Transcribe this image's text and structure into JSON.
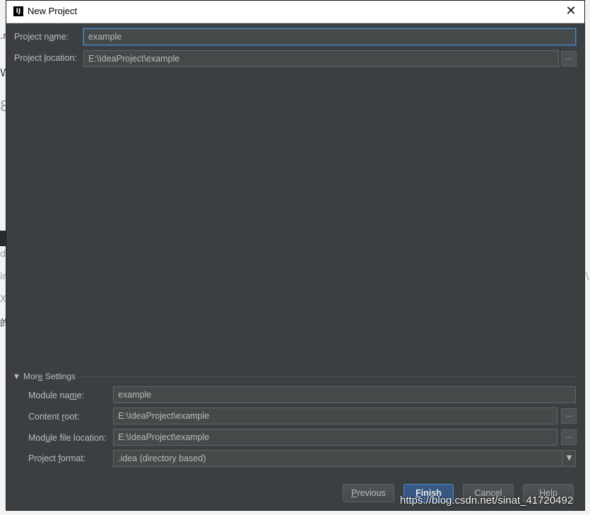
{
  "window": {
    "title": "New Project",
    "app_icon": "intellij-icon",
    "close_glyph": "✕"
  },
  "project": {
    "name_label_pre": "Project n",
    "name_label_mn": "a",
    "name_label_post": "me:",
    "name_value": "example",
    "location_label_pre": "Project ",
    "location_label_mn": "l",
    "location_label_post": "ocation:",
    "location_value": "E:\\IdeaProject\\example",
    "browse_glyph": "..."
  },
  "more_settings": {
    "toggle_glyph": "▼",
    "label_pre": "Mor",
    "label_mn": "e",
    "label_post": " Settings",
    "module_name_label_pre": "Module na",
    "module_name_label_mn": "m",
    "module_name_label_post": "e:",
    "module_name_value": "example",
    "content_root_label_pre": "Content ",
    "content_root_label_mn": "r",
    "content_root_label_post": "oot:",
    "content_root_value": "E:\\IdeaProject\\example",
    "module_file_label_pre": "Mod",
    "module_file_label_mn": "u",
    "module_file_label_post": "le file location:",
    "module_file_value": "E:\\IdeaProject\\example",
    "project_format_label_pre": "Project ",
    "project_format_label_mn": "f",
    "project_format_label_post": "ormat:",
    "project_format_value": ".idea (directory based)",
    "dropdown_glyph": "▼"
  },
  "buttons": {
    "previous_mn": "P",
    "previous_rest": "revious",
    "finish_mn": "F",
    "finish_rest": "inish",
    "cancel": "Cancel",
    "help": "Help"
  },
  "background": {
    "glyphs": [
      ".n",
      "W",
      "8",
      "d",
      "in",
      "X",
      "的",
      "\\"
    ]
  },
  "watermark": "https://blog.csdn.net/sinat_41720492"
}
